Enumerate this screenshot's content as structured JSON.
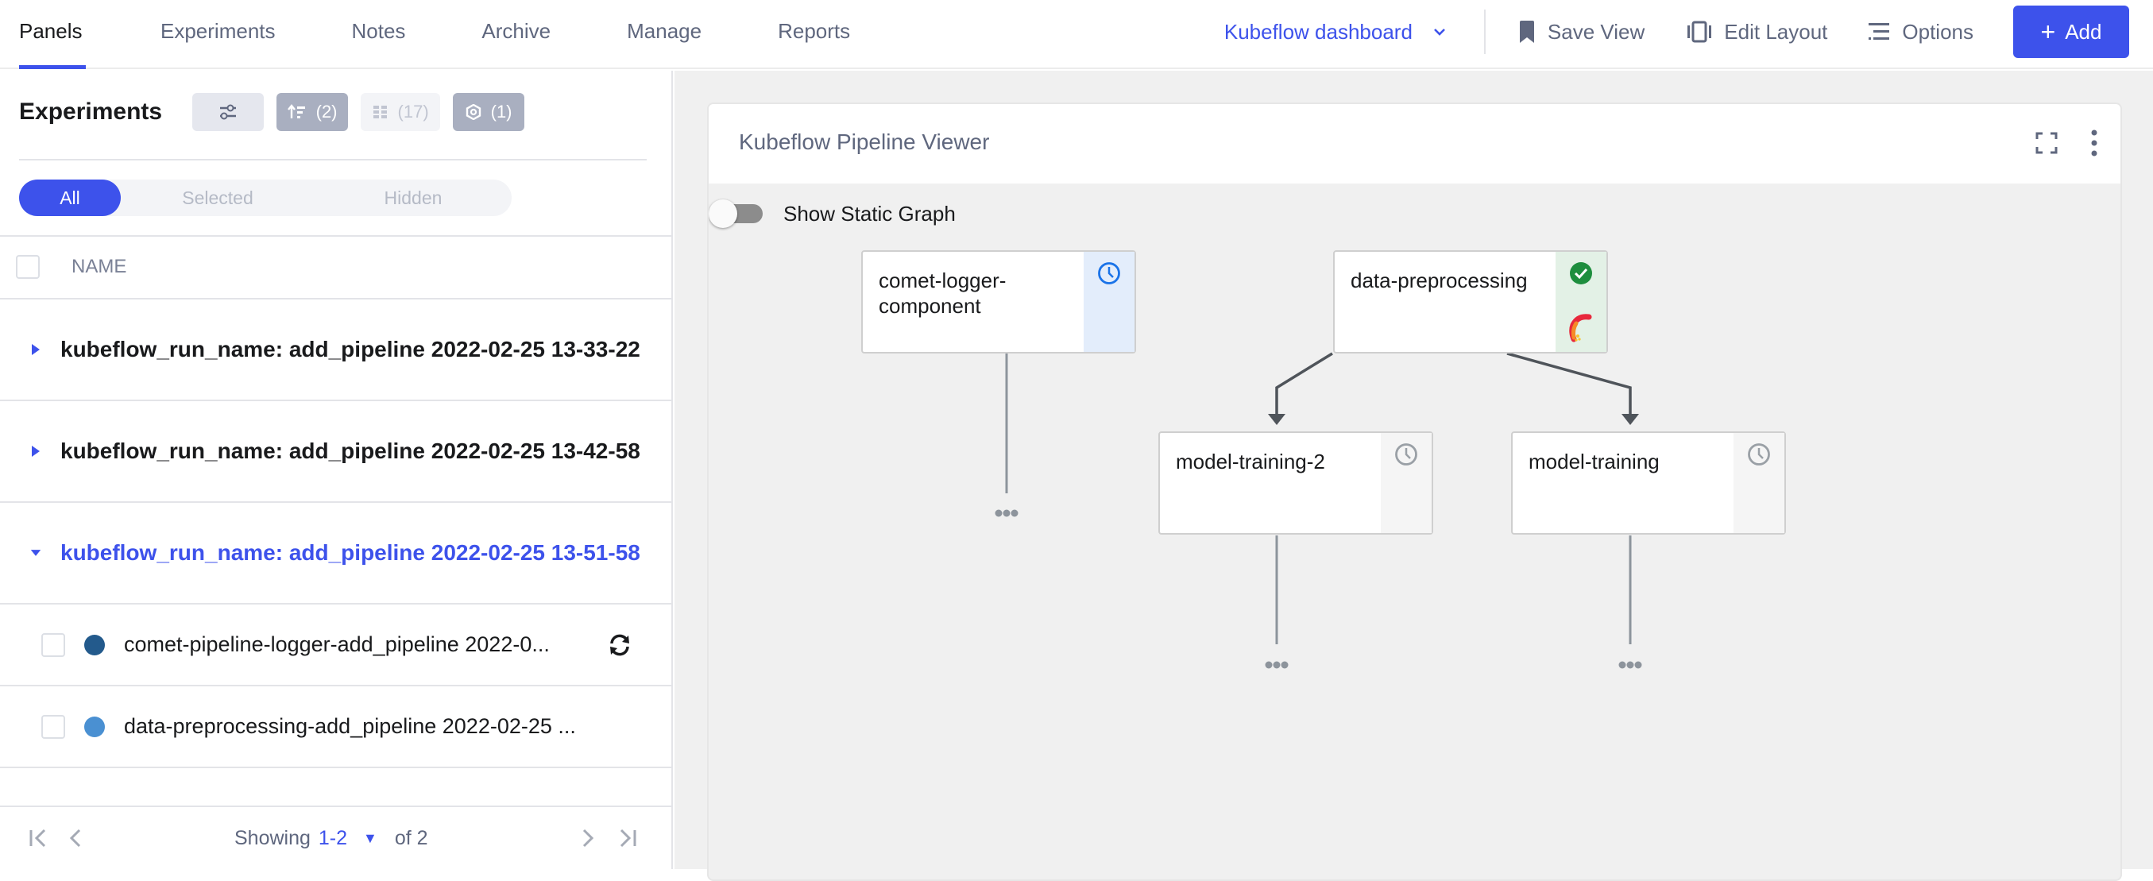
{
  "colors": {
    "accent": "#3d52eb",
    "status_success": "#1e8e3e",
    "status_pending": "#1a73e8",
    "dot_run1": "#235a8c",
    "dot_run2": "#4a90d2"
  },
  "nav": {
    "tabs": [
      {
        "label": "Panels",
        "active": true
      },
      {
        "label": "Experiments",
        "active": false
      },
      {
        "label": "Notes",
        "active": false
      },
      {
        "label": "Archive",
        "active": false
      },
      {
        "label": "Manage",
        "active": false
      },
      {
        "label": "Reports",
        "active": false
      }
    ]
  },
  "toolbar": {
    "dashboard_select": "Kubeflow dashboard",
    "save_view": "Save View",
    "edit_layout": "Edit Layout",
    "options": "Options",
    "add": "Add",
    "add_icon": "+"
  },
  "experiments_panel": {
    "title": "Experiments",
    "chips": {
      "sort_count": "(2)",
      "columns_count": "(17)",
      "filter_count": "(1)"
    },
    "segment": [
      "All",
      "Selected",
      "Hidden"
    ],
    "segment_active": "All",
    "column_header": "NAME",
    "groups": [
      {
        "label": "kubeflow_run_name: add_pipeline 2022-02-25 13-33-22",
        "expanded": false
      },
      {
        "label": "kubeflow_run_name: add_pipeline 2022-02-25 13-42-58",
        "expanded": false
      },
      {
        "label": "kubeflow_run_name: add_pipeline 2022-02-25 13-51-58",
        "expanded": true
      }
    ],
    "experiments": [
      {
        "label": "comet-pipeline-logger-add_pipeline 2022-0...",
        "running": true
      },
      {
        "label": "data-preprocessing-add_pipeline 2022-02-25 ...",
        "running": false
      }
    ],
    "pagination": {
      "showing_label": "Showing",
      "range": "1-2",
      "of_label": "of 2"
    }
  },
  "pipeline_panel": {
    "title": "Kubeflow Pipeline Viewer",
    "toggle_label": "Show Static Graph",
    "toggle_on": false,
    "nodes": [
      {
        "label": "comet-logger-component",
        "status": "pending-active"
      },
      {
        "label": "data-preprocessing",
        "status": "succeeded"
      },
      {
        "label": "model-training-2",
        "status": "pending"
      },
      {
        "label": "model-training",
        "status": "pending"
      }
    ],
    "ellipsis": "•••"
  }
}
